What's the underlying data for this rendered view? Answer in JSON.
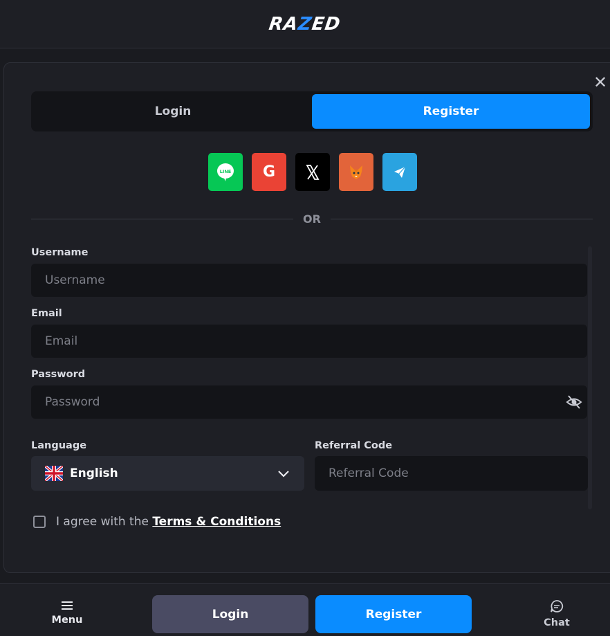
{
  "header": {
    "logo_left": "RA",
    "logo_z": "Z",
    "logo_right": "ED"
  },
  "modal": {
    "close_symbol": "✕",
    "tabs": [
      {
        "label": "Login",
        "active": false
      },
      {
        "label": "Register",
        "active": true
      }
    ],
    "social_logins": [
      {
        "name": "line",
        "icon": "line-icon",
        "color": "#06c755",
        "text": "LINE"
      },
      {
        "name": "google",
        "icon": "google-icon",
        "color": "#ea4335",
        "text": "G"
      },
      {
        "name": "x",
        "icon": "x-icon",
        "color": "#000000",
        "text": "𝕏"
      },
      {
        "name": "metamask",
        "icon": "metamask-fox-icon",
        "color": "#e2643a",
        "text": ""
      },
      {
        "name": "telegram",
        "icon": "telegram-icon",
        "color": "#2aa3e0",
        "text": ""
      }
    ],
    "divider_text": "OR",
    "fields": {
      "username": {
        "label": "Username",
        "placeholder": "Username",
        "value": ""
      },
      "email": {
        "label": "Email",
        "placeholder": "Email",
        "value": ""
      },
      "password": {
        "label": "Password",
        "placeholder": "Password",
        "value": ""
      },
      "language": {
        "label": "Language",
        "selected": "English"
      },
      "referral": {
        "label": "Referral Code",
        "placeholder": "Referral Code",
        "value": ""
      }
    },
    "agree": {
      "prefix": "I agree with the ",
      "link": "Terms & Conditions",
      "checked": false
    }
  },
  "bottom_nav": {
    "menu_label": "Menu",
    "login_label": "Login",
    "register_label": "Register",
    "chat_label": "Chat"
  },
  "colors": {
    "accent": "#0a8cff",
    "background": "#1a1b20",
    "panel": "#1e1f25",
    "input": "#131418"
  }
}
